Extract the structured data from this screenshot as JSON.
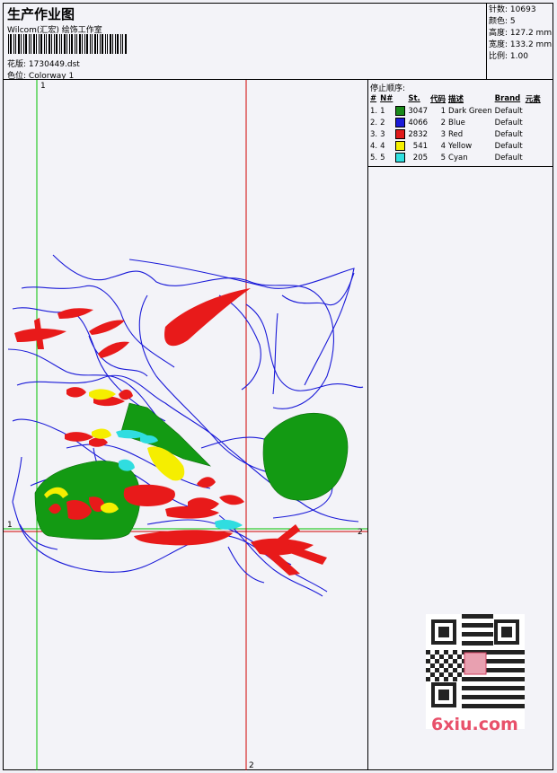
{
  "header": {
    "title": "生产作业图",
    "company": "Wilcom(汇宏) 绘饰工作室",
    "design_label": "花版:",
    "design_value": "1730449.dst",
    "colorway_label": "色位:",
    "colorway_value": "Colorway 1"
  },
  "stats": [
    {
      "label": "针数:",
      "value": "10693"
    },
    {
      "label": "颜色:",
      "value": "5"
    },
    {
      "label": "高度:",
      "value": "127.2 mm"
    },
    {
      "label": "宽度:",
      "value": "133.2 mm"
    },
    {
      "label": "比例:",
      "value": "1.00"
    }
  ],
  "legend": {
    "title": "停止顺序:",
    "columns": [
      "#",
      "N#",
      "St.",
      "代码",
      "描述",
      "Brand",
      "元素"
    ],
    "rows": [
      {
        "idx": "1.",
        "n": "1",
        "color": "#1a8a1a",
        "st": "3047",
        "code": "1",
        "desc": "Dark Green",
        "brand": "Default"
      },
      {
        "idx": "2.",
        "n": "2",
        "color": "#1a1ad8",
        "st": "4066",
        "code": "2",
        "desc": "Blue",
        "brand": "Default"
      },
      {
        "idx": "3.",
        "n": "3",
        "color": "#e01a1a",
        "st": "2832",
        "code": "3",
        "desc": "Red",
        "brand": "Default"
      },
      {
        "idx": "4.",
        "n": "4",
        "color": "#f5f000",
        "st": "541",
        "code": "4",
        "desc": "Yellow",
        "brand": "Default"
      },
      {
        "idx": "5.",
        "n": "5",
        "color": "#30e0e0",
        "st": "205",
        "code": "5",
        "desc": "Cyan",
        "brand": "Default"
      }
    ]
  },
  "axes": {
    "green_v_label": "1",
    "green_h_label": "1",
    "red_h_label": "2",
    "red_v_label": "2"
  },
  "watermark": {
    "text": "6xiu.com"
  }
}
